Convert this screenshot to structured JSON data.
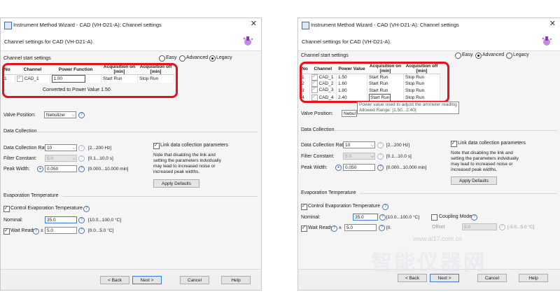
{
  "left": {
    "title": "Instrument Method Wizard - CAD (VH-D21-A): Channel settings",
    "header": "Channel settings for CAD (VH-D21-A).",
    "channel_start_label": "Channel start settings",
    "modes": [
      "Easy",
      "Advanced",
      "Legacy"
    ],
    "selected_mode": "Legacy",
    "table_headers": [
      "No",
      "Channel",
      "Power Function",
      "Acquisition on [min]",
      "Acquisition off [min]"
    ],
    "row": {
      "no": "1",
      "channel": "CAD_1",
      "power": "1.00",
      "acq_on": "Start Run",
      "acq_off": "Stop Run"
    },
    "converted": "Converted to Power Value 1.50",
    "valve_label": "Valve Position:",
    "valve_value": "Nebulizer",
    "data_collection_label": "Data Collection",
    "rate_label": "Data Collection Rate:",
    "rate_value": "10",
    "rate_range": "[2...200 Hz]",
    "filter_label": "Filter Constant:",
    "filter_value": "5.0",
    "filter_range": "[0.1...10.0 s]",
    "peak_label": "Peak Width:",
    "peak_value": "0.050",
    "peak_range": "[0.000...10.000 min]",
    "link_label": "Link data collection parameters",
    "note": [
      "Note that disabling the link and",
      "setting the parameters indvidually",
      "may lead to increased noise or",
      "increased peak widths."
    ],
    "apply_defaults": "Apply Defaults",
    "evap_label": "Evaporation Temperature",
    "control_evap": "Control Evaporation Temperature",
    "nominal_label": "Nominal:",
    "nominal_value": "35.0",
    "nominal_range": "[10.0...100.0 °C]",
    "wait_label": "Wait Ready",
    "pm": "±",
    "wait_value": "5.0",
    "wait_range": "[0.0...5.0 °C]",
    "buttons": {
      "back": "< Back",
      "next": "Next >",
      "cancel": "Cancel",
      "help": "Help"
    }
  },
  "right": {
    "title": "Instrument Method Wizard - CAD (VH-D21-A): Channel settings",
    "header": "Channel settings for CAD (VH-D21-A).",
    "channel_start_label": "Channel start settings",
    "modes": [
      "Easy",
      "Advanced",
      "Legacy"
    ],
    "selected_mode": "Advanced",
    "table_headers": [
      "No",
      "Channel",
      "Power Value",
      "Acquisition on [min]",
      "Acquisition off [min]"
    ],
    "rows": [
      {
        "no": "1",
        "channel": "CAD_1",
        "power": "1.50",
        "acq_on": "Start Run",
        "acq_off": "Stop Run"
      },
      {
        "no": "2",
        "channel": "CAD_2",
        "power": "1.60",
        "acq_on": "Start Run",
        "acq_off": "Stop Run"
      },
      {
        "no": "3",
        "channel": "CAD_3",
        "power": "1.80",
        "acq_on": "Start Run",
        "acq_off": "Stop Run"
      },
      {
        "no": "4",
        "channel": "CAD_4",
        "power": "2.40",
        "acq_on": "Start Run",
        "acq_off": "Stop Run"
      }
    ],
    "tooltip_1": "Power value used to adjust the ammeter reading",
    "tooltip_2": "Allowed Range: [1.50...2.40]",
    "valve_label": "Valve Position:",
    "valve_value": "Nebul",
    "data_collection_label": "Data Collection",
    "rate_label": "Data Collection Rate:",
    "rate_value": "10",
    "rate_range": "[2...200 Hz]",
    "filter_label": "Filter Constant:",
    "filter_value": "5.0",
    "filter_range": "[0.1...10.0 s]",
    "peak_label": "Peak Width:",
    "peak_value": "0.050",
    "peak_range": "[0.000...10.000 min]",
    "link_label": "Link data collection parameters",
    "note": [
      "Note that disabling the link and",
      "setting the parameters indvidually",
      "may lead to increased noise or",
      "increased peak widths."
    ],
    "apply_defaults": "Apply Defaults",
    "evap_label": "Evaporation Temperature",
    "control_evap": "Control Evaporation Temperature",
    "nominal_label": "Nominal:",
    "nominal_value": "35.0",
    "nominal_range": "[10.0...100.0 °C]",
    "coupling_label": "Coupling Mode",
    "offset_label": "Offset",
    "offset_value": "5.0",
    "offset_range": "[-5.0...5.0 °C]",
    "wait_label": "Wait Ready",
    "pm": "±",
    "wait_value": "5.0",
    "wait_range": "[0.",
    "buttons": {
      "back": "< Back",
      "next": "Next >",
      "cancel": "Cancel",
      "help": "Help"
    }
  },
  "watermark": {
    "text": "智能仪器网",
    "url": "www.ai17.com.cn"
  },
  "colors": {
    "highlight": "#e8101a",
    "accent": "#3d7bd9"
  }
}
